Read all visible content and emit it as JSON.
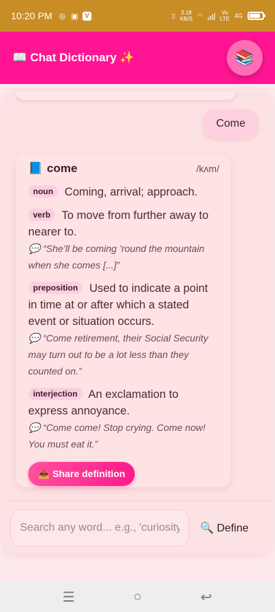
{
  "status_bar": {
    "time": "10:20 PM",
    "data_speed_value": "3.18",
    "data_speed_unit": "KB/S",
    "network_top": "Vo",
    "network_bottom": "LTE",
    "network_type": "4G",
    "battery_level": 0.85
  },
  "header": {
    "title": "📖 Chat Dictionary ✨",
    "menu_icon": "📚"
  },
  "chat": {
    "user_message": "Come",
    "definition": {
      "book_icon": "📘",
      "word": "come",
      "phonetic": "/kʌm/",
      "senses": [
        {
          "pos": "noun",
          "text": "Coming, arrival; approach.",
          "example": ""
        },
        {
          "pos": "verb",
          "text": "To move from further away to nearer to.",
          "example": "💬 “She’ll be coming ’round the mountain when she comes [...]”"
        },
        {
          "pos": "preposition",
          "text": "Used to indicate a point in time at or after which a stated event or situation occurs.",
          "example": "💬 “Come retirement, their Social Security may turn out to be a lot less than they counted on.”"
        },
        {
          "pos": "interjection",
          "text": "An exclamation to express annoyance.",
          "example": "💬 “Come come! Stop crying.     Come now! You must eat it.”"
        }
      ],
      "share_label": "📤 Share definition"
    }
  },
  "input": {
    "placeholder": "Search any word... e.g., 'curiosity'",
    "value": "",
    "define_label": "🔍 Define"
  },
  "nav": {
    "recent_icon": "☰",
    "home_icon": "○",
    "back_icon": "↩"
  },
  "colors": {
    "status_bar": "#c98d26",
    "header": "#ff1493",
    "accent": "#ff4fa0",
    "background": "#fde8ec"
  }
}
